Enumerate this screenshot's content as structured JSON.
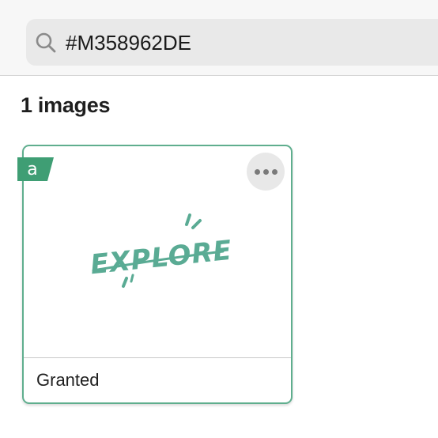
{
  "search": {
    "value": "#M358962DE"
  },
  "results": {
    "count_label": "1 images"
  },
  "card": {
    "badge_letter": "a",
    "artwork_text": "EXPLORE",
    "status_label": "Granted"
  },
  "colors": {
    "accent": "#5fae8e",
    "badge": "#3f9e74",
    "artwork": "#5aab94"
  },
  "icons": {
    "search": "search-icon",
    "more": "more-options-icon",
    "badge": "license-badge-icon"
  }
}
